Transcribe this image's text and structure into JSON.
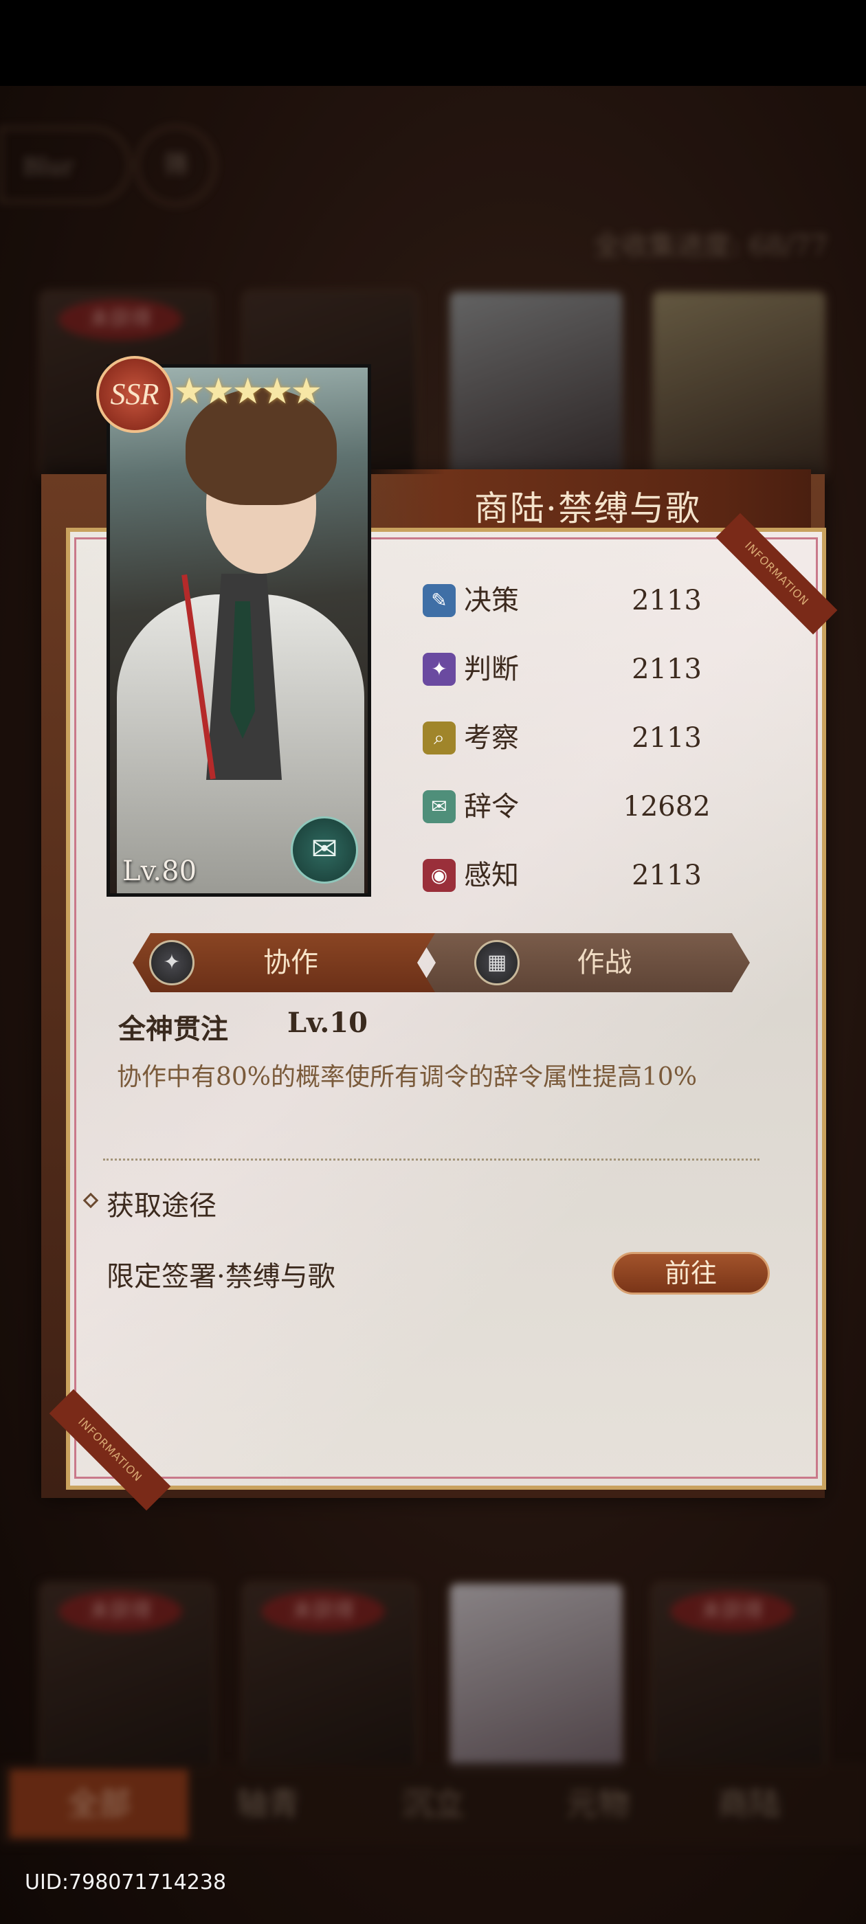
{
  "background": {
    "filter_label": "Blur",
    "filter_short": "筛",
    "progress": "全收集进度: 68/77",
    "card_stamp": "未获得",
    "tabs": [
      "全部",
      "轴青",
      "沉立",
      "元物",
      "商陆"
    ]
  },
  "card": {
    "rarity": "SSR",
    "stars": "★★★★★",
    "star_count": 5,
    "level": "Lv.80",
    "badge_glyph": "✉"
  },
  "title": "商陆·禁缚与歌",
  "corner_ribbon": "INFORMATION",
  "stats": [
    {
      "name": "决策",
      "value": "2113",
      "glyph": "✎",
      "color": "#3f6fa6"
    },
    {
      "name": "判断",
      "value": "2113",
      "glyph": "✦",
      "color": "#6a4aa0"
    },
    {
      "name": "考察",
      "value": "2113",
      "glyph": "⌕",
      "color": "#a0852a"
    },
    {
      "name": "辞令",
      "value": "12682",
      "glyph": "✉",
      "color": "#4f8f7a"
    },
    {
      "name": "感知",
      "value": "2113",
      "glyph": "◉",
      "color": "#9a2f3a"
    }
  ],
  "tabs": {
    "collab": "协作",
    "battle": "作战"
  },
  "skill": {
    "name": "全神贯注",
    "level": "Lv.10",
    "description": "协作中有80%的概率使所有调令的辞令属性提高10%"
  },
  "source": {
    "title": "获取途径",
    "item": "限定签署·禁缚与歌",
    "button": "前往"
  },
  "uid": "UID:798071714238"
}
